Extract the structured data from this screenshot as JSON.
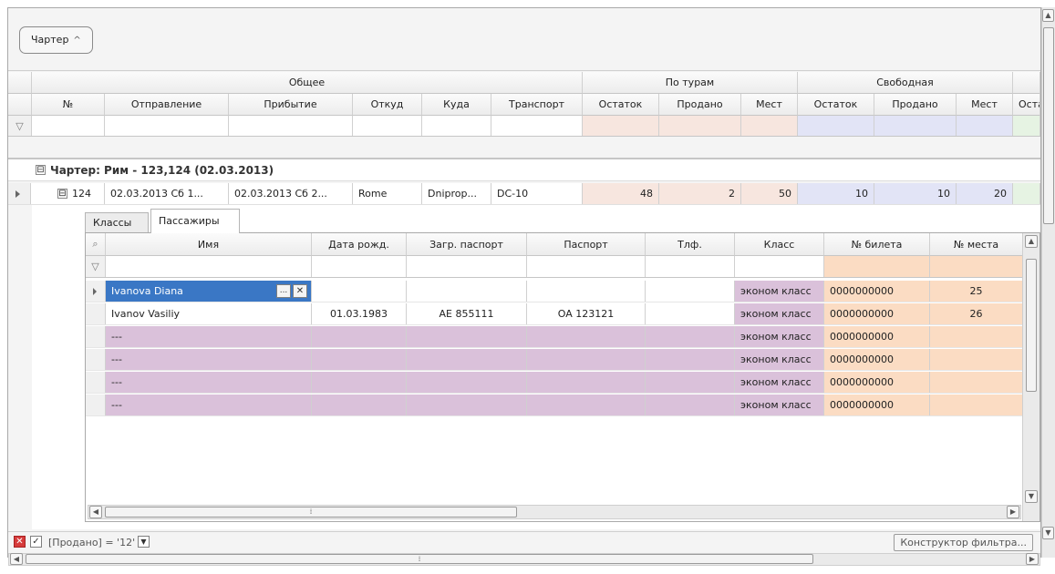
{
  "group_panel": {
    "chip_label": "Чартер",
    "chip_arrow": "^"
  },
  "bands": {
    "general": "Общее",
    "by_tours": "По турам",
    "free": "Свободная"
  },
  "columns": {
    "num": "№",
    "departure": "Отправление",
    "arrival": "Прибытие",
    "from": "Откуд",
    "to": "Куда",
    "transport": "Транспорт",
    "tour_rest": "Остаток",
    "tour_sold": "Продано",
    "tour_seats": "Мест",
    "free_rest": "Остаток",
    "free_sold": "Продано",
    "free_seats": "Мест",
    "extra": "Оста"
  },
  "group_row": {
    "toggle": "⊟",
    "label": "Чартер: Рим - 123,124 (02.03.2013)"
  },
  "main_row": {
    "num": "124",
    "departure": "02.03.2013 Сб 1...",
    "arrival": "02.03.2013 Сб 2...",
    "from": "Rome",
    "to": "Dniprop...",
    "transport": "DC-10",
    "tour_rest": "48",
    "tour_sold": "2",
    "tour_seats": "50",
    "free_rest": "10",
    "free_sold": "10",
    "free_seats": "20"
  },
  "tabs": {
    "classes": "Классы",
    "passengers": "Пассажиры"
  },
  "detail_columns": {
    "name": "Имя",
    "dob": "Дата рожд.",
    "foreign_passport": "Загр. паспорт",
    "passport": "Паспорт",
    "phone": "Тлф.",
    "class": "Класс",
    "ticket": "№ билета",
    "seat": "№ места"
  },
  "passengers": [
    {
      "name": "Ivanova Diana",
      "dob": "",
      "foreign_passport": "",
      "passport": "",
      "phone": "",
      "class": "эконом класс",
      "ticket": "0000000000",
      "seat": "25"
    },
    {
      "name": "Ivanov Vasiliy",
      "dob": "01.03.1983",
      "foreign_passport": "AE 855111",
      "passport": "OA 123121",
      "phone": "",
      "class": "эконом класс",
      "ticket": "0000000000",
      "seat": "26"
    },
    {
      "name": "---",
      "dob": "",
      "foreign_passport": "",
      "passport": "",
      "phone": "",
      "class": "эконом класс",
      "ticket": "0000000000",
      "seat": ""
    },
    {
      "name": "---",
      "dob": "",
      "foreign_passport": "",
      "passport": "",
      "phone": "",
      "class": "эконом класс",
      "ticket": "0000000000",
      "seat": ""
    },
    {
      "name": "---",
      "dob": "",
      "foreign_passport": "",
      "passport": "",
      "phone": "",
      "class": "эконом класс",
      "ticket": "0000000000",
      "seat": ""
    },
    {
      "name": "---",
      "dob": "",
      "foreign_passport": "",
      "passport": "",
      "phone": "",
      "class": "эконом класс",
      "ticket": "0000000000",
      "seat": ""
    }
  ],
  "editor_buttons": {
    "ellipsis": "...",
    "clear": "✕"
  },
  "footer": {
    "filter_text": "[Продано] = '12'",
    "builder_button": "Конструктор фильтра..."
  },
  "colors": {
    "selection": "#3a77c5",
    "tour_band": "#f7e6df",
    "free_band": "#e2e4f6",
    "ticket_band": "#fbdcc3",
    "empty_row": "#dac1da"
  }
}
